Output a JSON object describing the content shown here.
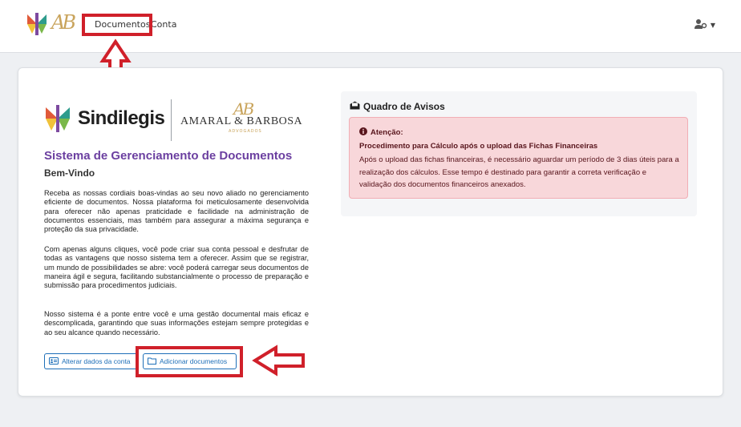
{
  "nav": {
    "documents_label": "Documentos",
    "account_label": "Conta",
    "user_icon": "user-gear-icon"
  },
  "brand": {
    "name": "Sindilegis",
    "firm_monogram": "AB",
    "firm_name": "AMARAL & BARBOSA",
    "firm_subtitle": "ADVOGADOS"
  },
  "main": {
    "title": "Sistema de Gerenciamento de Documentos",
    "welcome": "Bem-Vindo",
    "paragraphs": [
      "Receba as nossas cordiais boas-vindas ao seu novo aliado no gerenciamento eficiente de documentos. Nossa plataforma foi meticulosamente desenvolvida para oferecer não apenas praticidade e facilidade na administração de documentos essenciais, mas também para assegurar a máxima segurança e proteção da sua privacidade.",
      "Com apenas alguns cliques, você pode criar sua conta pessoal e desfrutar de todas as vantagens que nosso sistema tem a oferecer. Assim que se registrar, um mundo de possibilidades se abre: você poderá carregar seus documentos de maneira ágil e segura, facilitando substancialmente o processo de preparação e submissão para procedimentos judiciais.",
      "Nosso sistema é a ponte entre você e uma gestão documental mais eficaz e descomplicada, garantindo que suas informações estejam sempre protegidas e ao seu alcance quando necessário."
    ],
    "btn_edit_account": "Alterar dados da conta",
    "btn_add_documents": "Adicionar documentos"
  },
  "notices": {
    "title": "Quadro de Avisos",
    "alert_heading": "Atenção:",
    "alert_subheading": "Procedimento para Cálculo após o upload das Fichas Financeiras",
    "alert_body": "Após o upload das fichas financeiras, é necessário aguardar um período de 3 dias úteis para a realização dos cálculos. Esse tempo é destinado para garantir a correta verificação e validação dos documentos financeiros anexados."
  },
  "colors": {
    "title_purple": "#6b3fa0",
    "button_blue": "#1e6fb8",
    "alert_bg": "#f8d7da",
    "annotation_red": "#d0202a",
    "gold": "#c9a45c"
  }
}
